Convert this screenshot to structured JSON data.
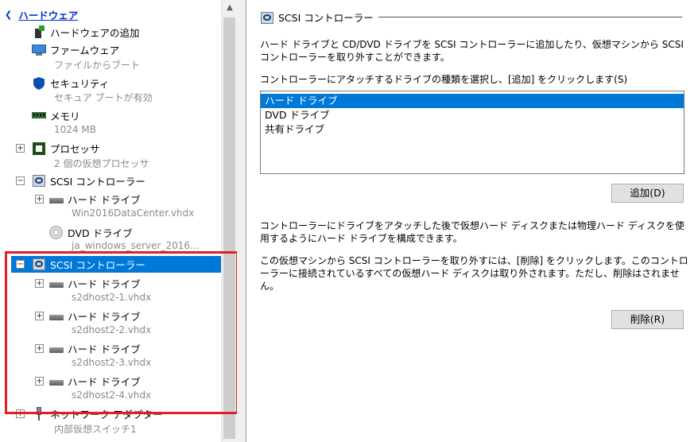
{
  "tree": {
    "hardware_header": "ハードウェア",
    "add_hardware": "ハードウェアの追加",
    "firmware": {
      "label": "ファームウェア",
      "sub": "ファイルからブート"
    },
    "security": {
      "label": "セキュリティ",
      "sub": "セキュア ブートが有効"
    },
    "memory": {
      "label": "メモリ",
      "sub": "1024 MB"
    },
    "processor": {
      "label": "プロセッサ",
      "sub": "2 個の仮想プロセッサ"
    },
    "scsi1": {
      "label": "SCSI コントローラー",
      "hdd": {
        "label": "ハード ドライブ",
        "sub": "Win2016DataCenter.vhdx"
      },
      "dvd": {
        "label": "DVD ドライブ",
        "sub": "ja_windows_server_2016..."
      }
    },
    "scsi2": {
      "label": "SCSI コントローラー",
      "drives": [
        {
          "label": "ハード ドライブ",
          "sub": "s2dhost2-1.vhdx"
        },
        {
          "label": "ハード ドライブ",
          "sub": "s2dhost2-2.vhdx"
        },
        {
          "label": "ハード ドライブ",
          "sub": "s2dhost2-3.vhdx"
        },
        {
          "label": "ハード ドライブ",
          "sub": "s2dhost2-4.vhdx"
        }
      ]
    },
    "network": {
      "label": "ネットワーク アダプター",
      "sub": "内部仮想スイッチ1"
    }
  },
  "panel": {
    "title": "SCSI コントローラー",
    "desc1": "ハード ドライブと CD/DVD ドライブを SCSI コントローラーに追加したり、仮想マシンから SCSI コントローラーを取り外すことができます。",
    "prompt": "コントローラーにアタッチするドライブの種類を選択し、[追加] をクリックします(S)",
    "options": [
      "ハード ドライブ",
      "DVD ドライブ",
      "共有ドライブ"
    ],
    "add_button": "追加(D)",
    "desc2": "コントローラーにドライブをアタッチした後で仮想ハード ディスクまたは物理ハード ディスクを使用するようにハード ドライブを構成できます。",
    "desc3": "この仮想マシンから SCSI コントローラーを取り外すには、[削除] をクリックします。このコントローラーに接続されているすべての仮想ハード ディスクは取り外されます。ただし、削除はされません。",
    "remove_button": "削除(R)"
  },
  "colors": {
    "selection": "#0078d7",
    "highlight_box": "#e41e26",
    "header": "#0033cc"
  }
}
